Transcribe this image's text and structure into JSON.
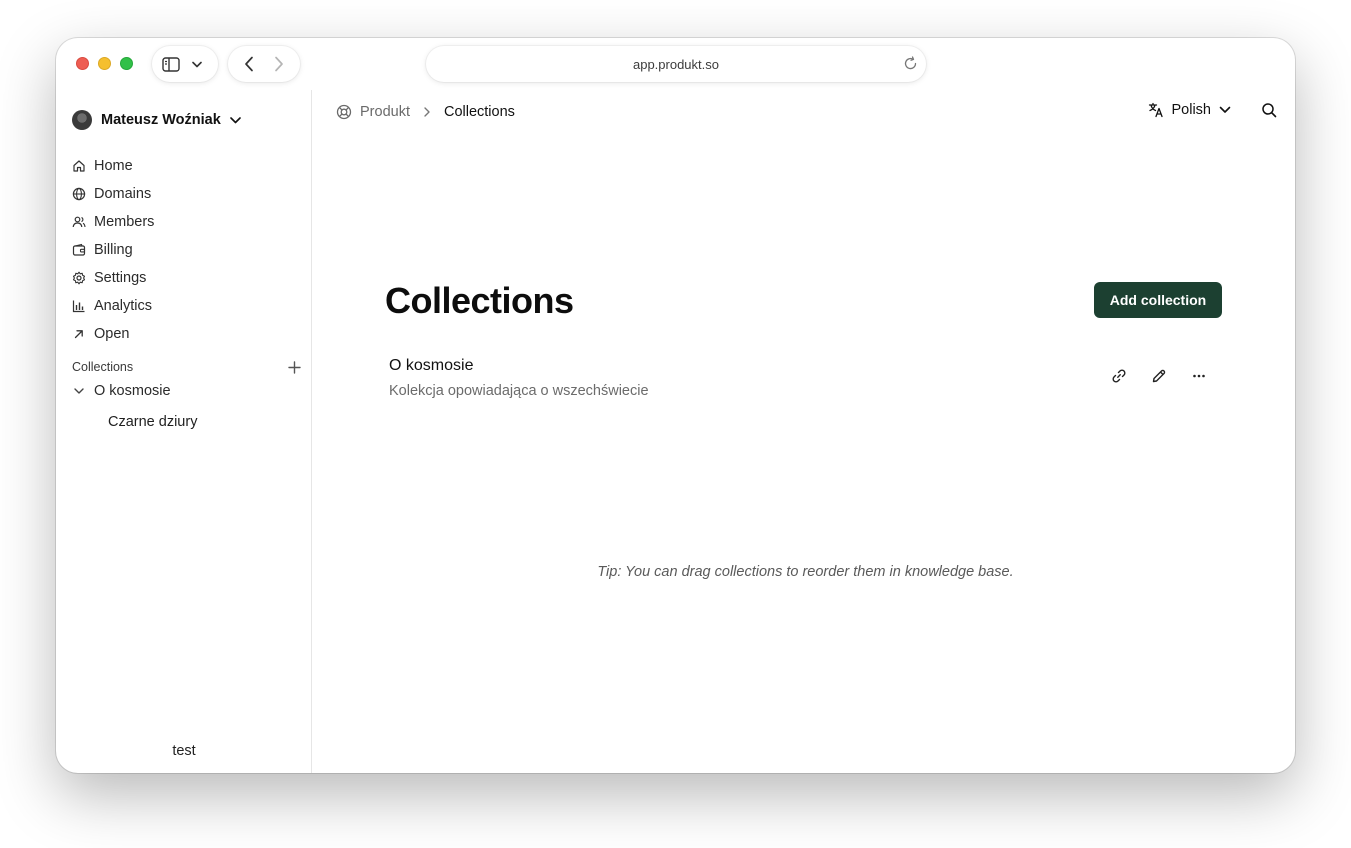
{
  "browser": {
    "url": "app.produkt.so"
  },
  "sidebar": {
    "user_name": "Mateusz Woźniak",
    "items": [
      {
        "label": "Home",
        "icon": "home-icon"
      },
      {
        "label": "Domains",
        "icon": "globe-icon"
      },
      {
        "label": "Members",
        "icon": "users-icon"
      },
      {
        "label": "Billing",
        "icon": "wallet-icon"
      },
      {
        "label": "Settings",
        "icon": "gear-icon"
      },
      {
        "label": "Analytics",
        "icon": "bar-chart-icon"
      },
      {
        "label": "Open",
        "icon": "arrow-up-right-icon"
      }
    ],
    "collections_title": "Collections",
    "collections": [
      {
        "label": "O kosmosie",
        "children": [
          "Czarne dziury"
        ]
      }
    ],
    "footer": "test"
  },
  "header": {
    "breadcrumb_root": "Produkt",
    "breadcrumb_current": "Collections",
    "language": "Polish"
  },
  "main": {
    "title": "Collections",
    "add_button": "Add collection",
    "collection_card": {
      "name": "O kosmosie",
      "description": "Kolekcja opowiadająca o wszechświecie"
    },
    "tip": "Tip: You can drag collections to reorder them in knowledge base."
  },
  "colors": {
    "accent": "#1c4031"
  }
}
